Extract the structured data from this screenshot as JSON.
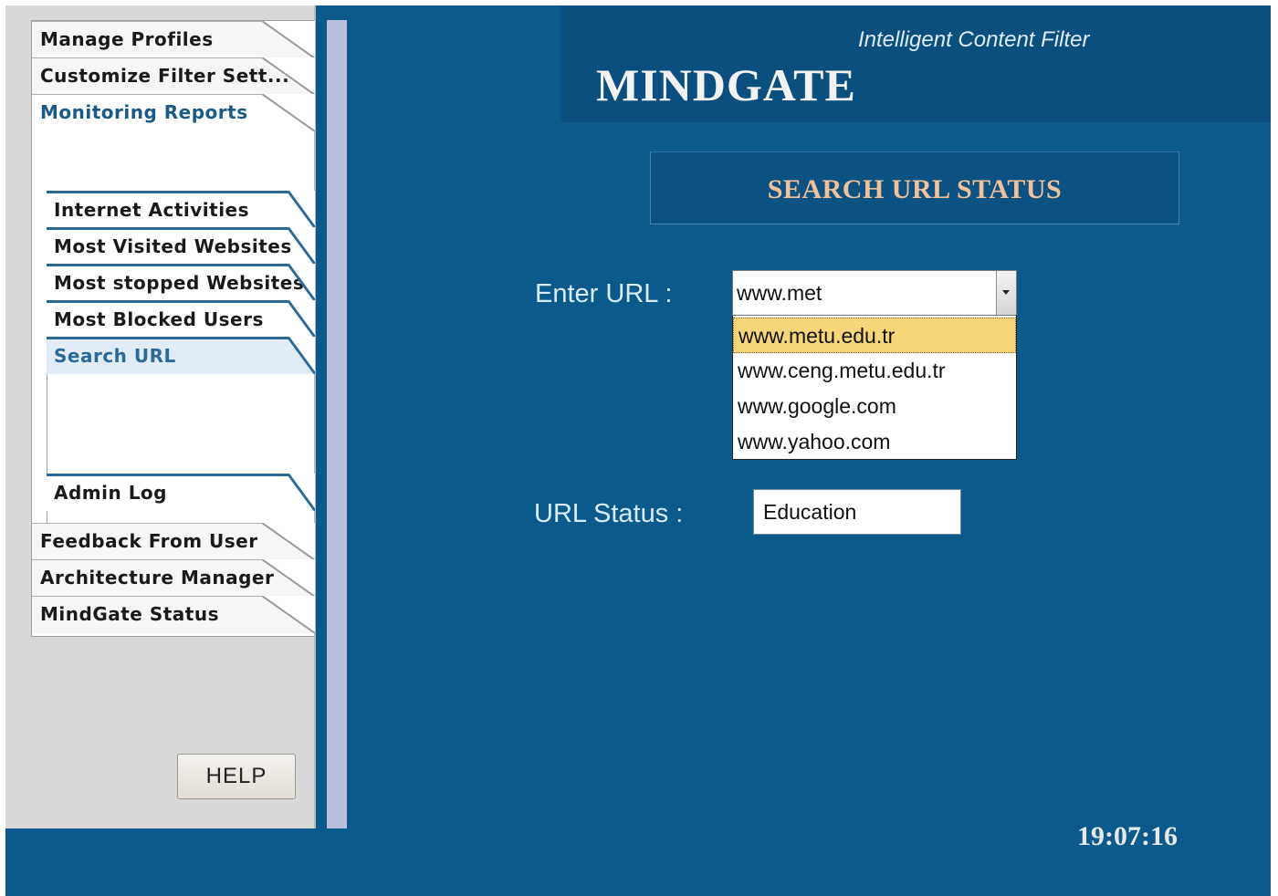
{
  "sidebar": {
    "tabs_top": [
      "Manage Profiles",
      "Customize Filter Sett...",
      "Monitoring Reports"
    ],
    "sub_items": [
      "Internet Activities",
      "Most Visited Websites",
      "Most stopped Websites",
      "Most Blocked Users",
      "Search URL"
    ],
    "admin_log": "Admin Log",
    "tabs_bottom": [
      "Feedback From User",
      "Architecture Manager",
      "MindGate Status"
    ],
    "active_tab": "Monitoring Reports",
    "active_sub_item": "Search URL",
    "help_label": "HELP"
  },
  "header": {
    "tagline": "Intelligent Content Filter",
    "brand": "MINDGATE"
  },
  "main": {
    "section_title": "SEARCH URL STATUS",
    "url_label": "Enter URL :",
    "url_value": "www.met",
    "url_suggestions": [
      "www.metu.edu.tr",
      "www.ceng.metu.edu.tr",
      "www.google.com",
      "www.yahoo.com"
    ],
    "highlighted_suggestion": "www.metu.edu.tr",
    "status_label": "URL Status :",
    "status_value": "Education"
  },
  "clock": "19:07:16",
  "colors": {
    "background": "#0c5a8c",
    "header": "#0a4f7e",
    "section_title": "#f2c099",
    "highlight": "#f7d67a",
    "active_nav": "#1a5a88"
  }
}
